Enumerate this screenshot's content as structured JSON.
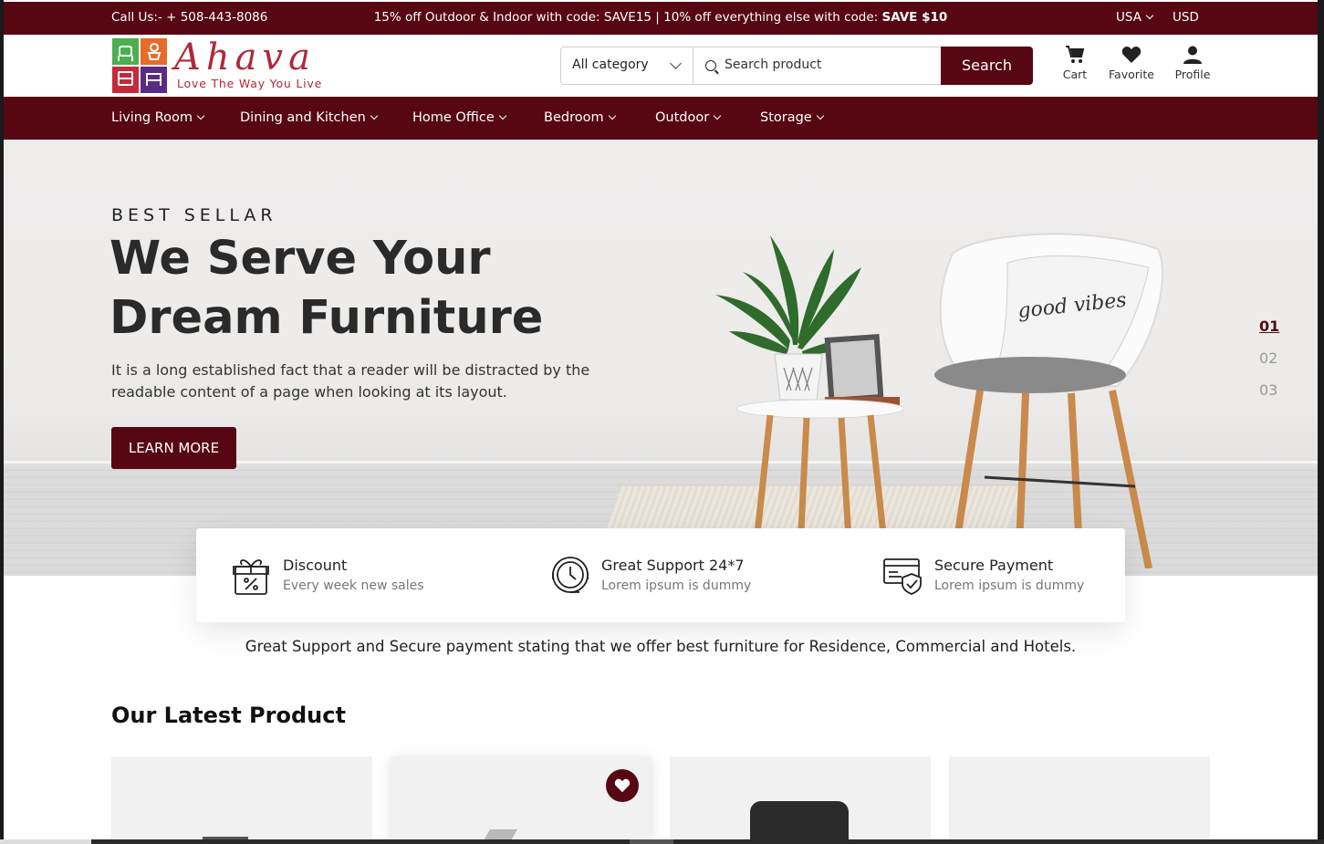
{
  "topbar": {
    "call": "Call Us:- + 508-443-8086",
    "promo_text": "15% off Outdoor & Indoor with code: SAVE15 | 10% off everything else with code: ",
    "promo_code": "SAVE $10",
    "country": "USA",
    "currency": "USD"
  },
  "brand": {
    "name": "Ahava",
    "tagline": "Love The Way You Live",
    "colors": [
      "#4caf50",
      "#e86b2a",
      "#c62a3a",
      "#5b2a86"
    ]
  },
  "search": {
    "category": "All category",
    "placeholder": "Search product",
    "button": "Search"
  },
  "header_icons": {
    "cart": "Cart",
    "favorite": "Favorite",
    "profile": "Profile"
  },
  "nav": {
    "items": [
      {
        "label": "Living Room"
      },
      {
        "label": "Dining and Kitchen"
      },
      {
        "label": "Home Office"
      },
      {
        "label": "Bedroom"
      },
      {
        "label": "Outdoor"
      },
      {
        "label": "Storage"
      }
    ]
  },
  "hero": {
    "eyebrow": "BEST SELLAR",
    "title": "We Serve Your Dream Furniture",
    "description": "It is a long established fact that a reader will be distracted by the readable content of a page when looking at its layout.",
    "cta": "LEARN MORE",
    "slides": [
      "01",
      "02",
      "03"
    ],
    "active_slide": "01",
    "pillow_text": "good vibes"
  },
  "features": [
    {
      "icon": "gift-discount-icon",
      "title": "Discount",
      "subtitle": "Every week new sales"
    },
    {
      "icon": "support-clock-icon",
      "title": "Great Support 24*7",
      "subtitle": "Lorem ipsum is dummy"
    },
    {
      "icon": "secure-card-icon",
      "title": "Secure Payment",
      "subtitle": "Lorem ipsum is dummy"
    }
  ],
  "tagline": "Great Support and Secure payment stating that we offer best furniture for Residence, Commercial and Hotels.",
  "latest": {
    "title": "Our Latest Product"
  },
  "theme": {
    "primary": "#560711"
  }
}
